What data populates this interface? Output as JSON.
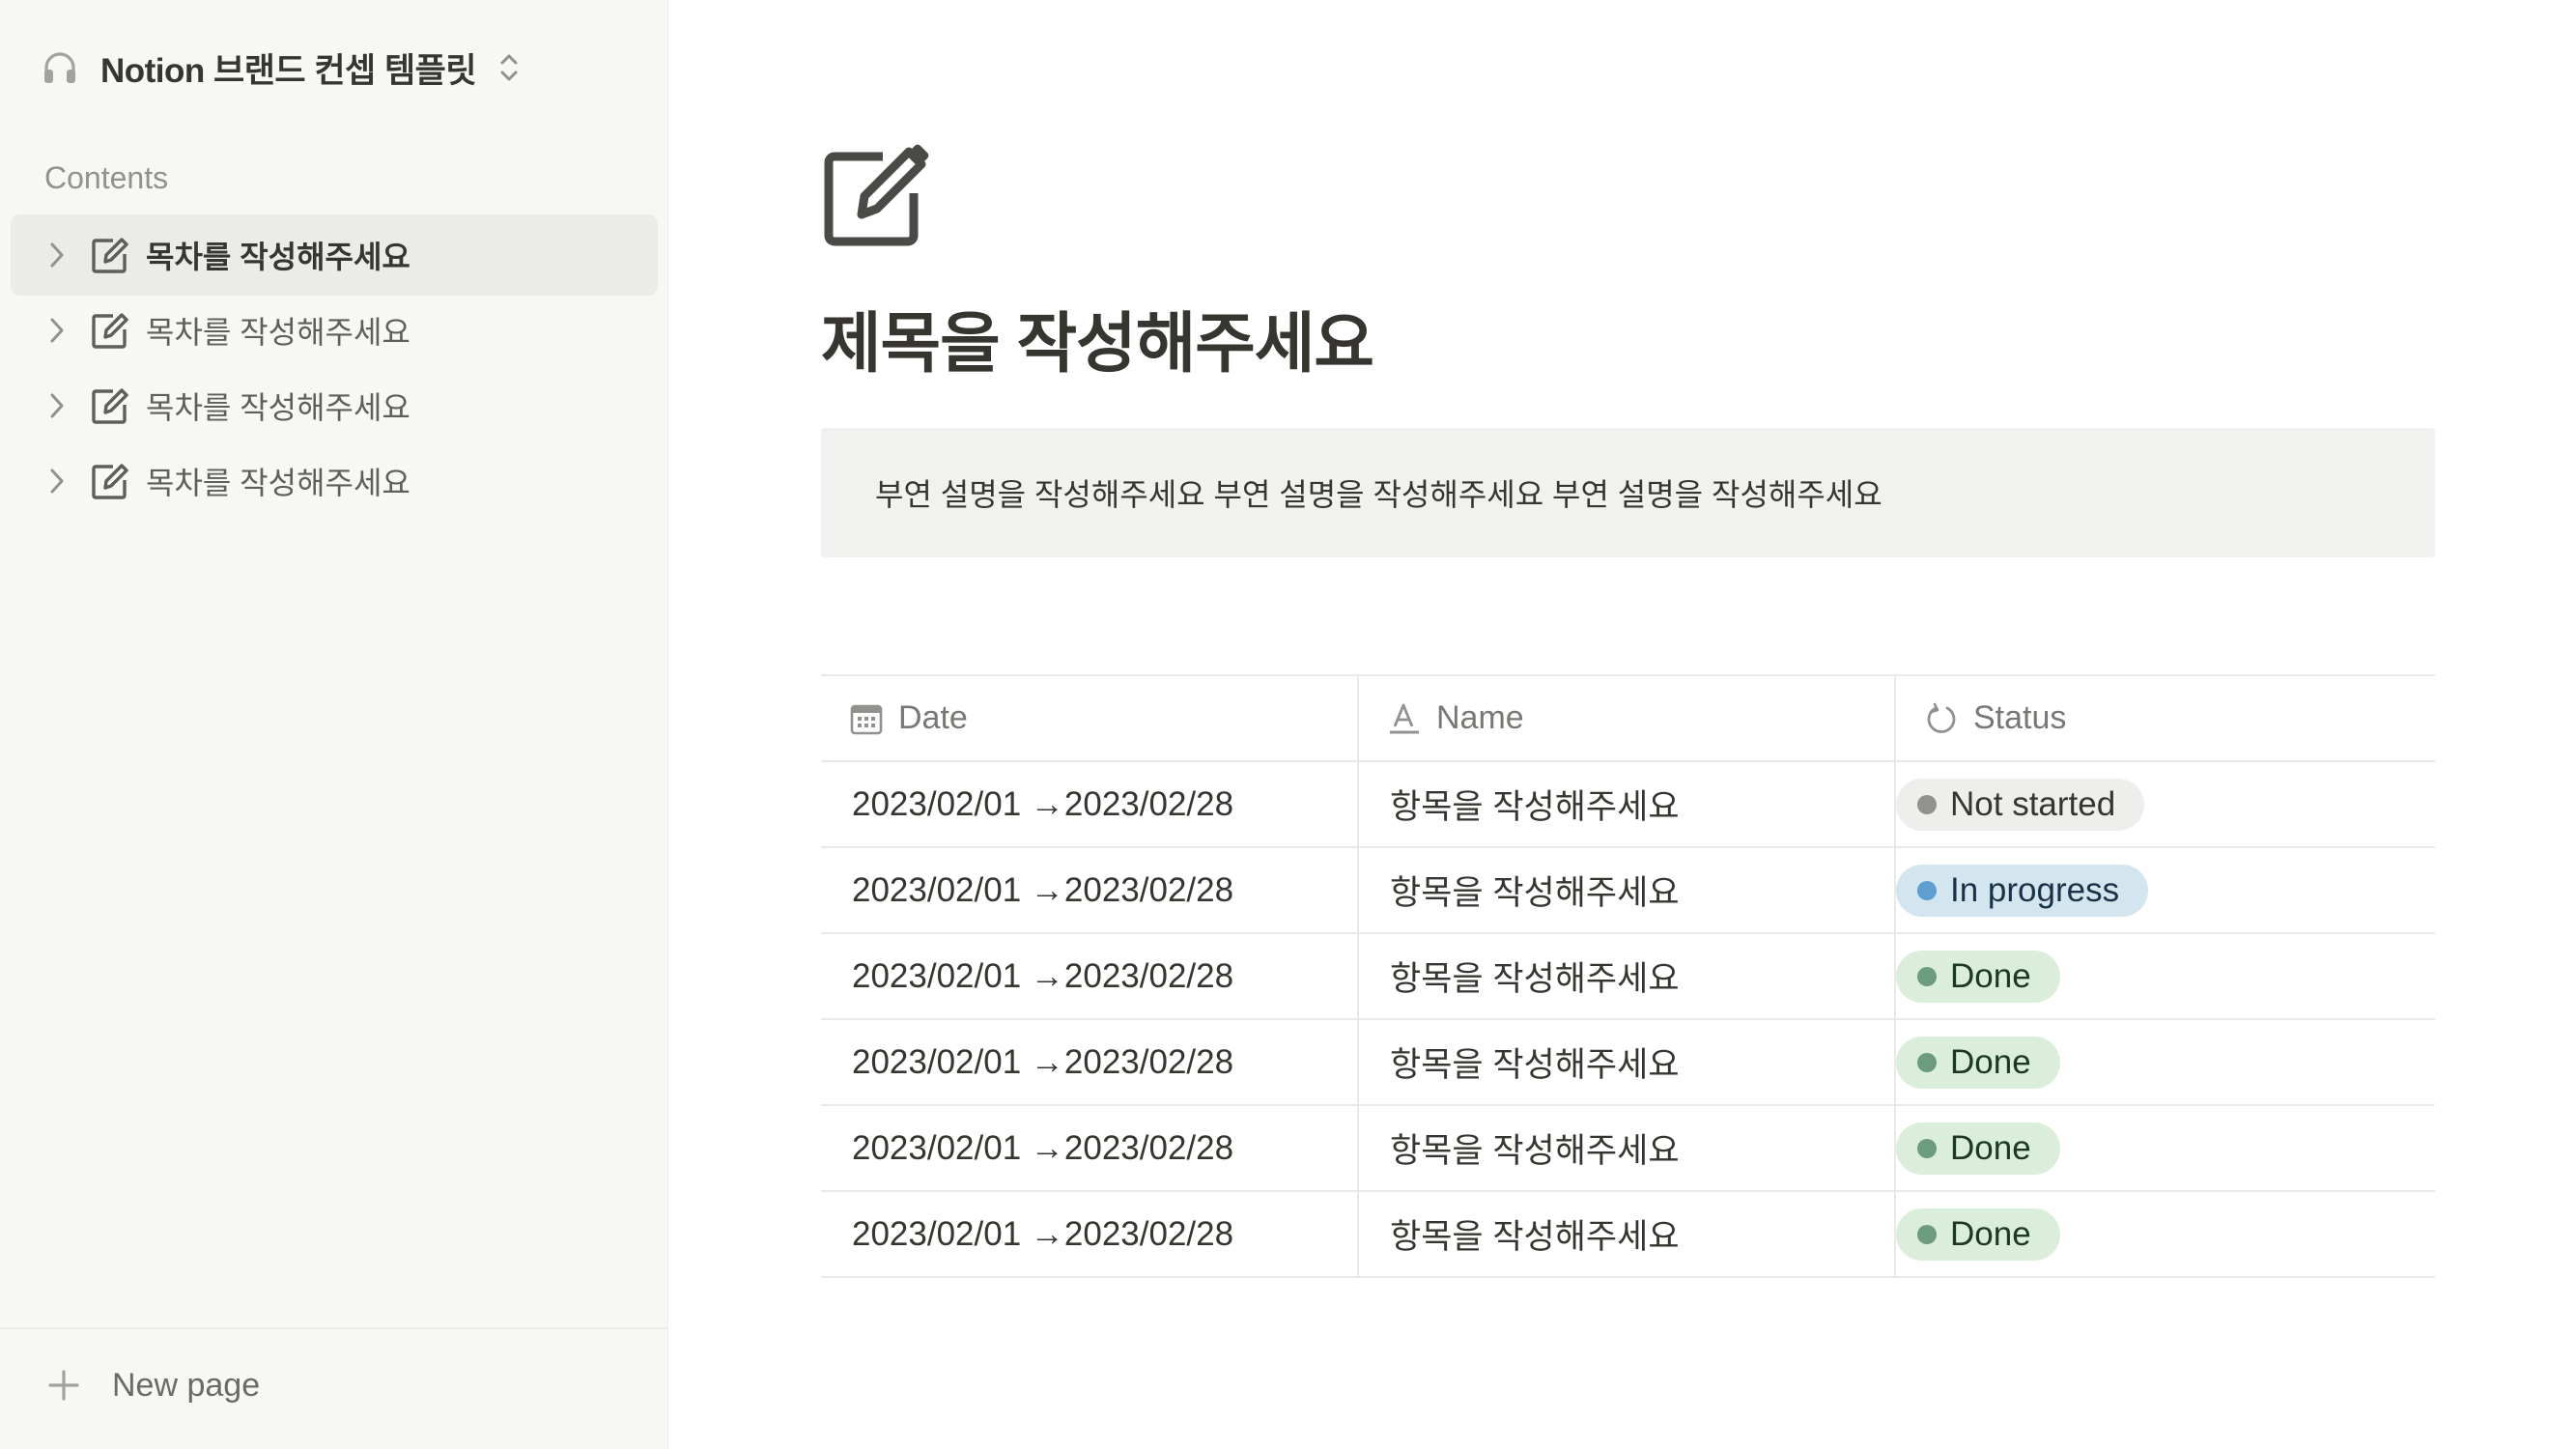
{
  "sidebar": {
    "workspace_name": "Notion 브랜드 컨셉 템플릿",
    "workspace_icon": "headphones-icon",
    "section_label": "Contents",
    "items": [
      {
        "label": "목차를 작성해주세요",
        "active": true
      },
      {
        "label": "목차를 작성해주세요",
        "active": false
      },
      {
        "label": "목차를 작성해주세요",
        "active": false
      },
      {
        "label": "목차를 작성해주세요",
        "active": false
      }
    ],
    "new_page_label": "New page"
  },
  "page": {
    "icon": "edit-icon",
    "title": "제목을 작성해주세요",
    "callout": "부연 설명을 작성해주세요 부연 설명을 작성해주세요 부연 설명을 작성해주세요"
  },
  "table": {
    "columns": [
      {
        "label": "Date",
        "icon": "calendar-icon"
      },
      {
        "label": "Name",
        "icon": "text-property-icon"
      },
      {
        "label": "Status",
        "icon": "status-icon"
      }
    ],
    "rows": [
      {
        "date": "2023/02/01 →2023/02/28",
        "name": "항목을 작성해주세요",
        "status": "Not started"
      },
      {
        "date": "2023/02/01 →2023/02/28",
        "name": "항목을 작성해주세요",
        "status": "In progress"
      },
      {
        "date": "2023/02/01 →2023/02/28",
        "name": "항목을 작성해주세요",
        "status": "Done"
      },
      {
        "date": "2023/02/01 →2023/02/28",
        "name": "항목을 작성해주세요",
        "status": "Done"
      },
      {
        "date": "2023/02/01 →2023/02/28",
        "name": "항목을 작성해주세요",
        "status": "Done"
      },
      {
        "date": "2023/02/01 →2023/02/28",
        "name": "항목을 작성해주세요",
        "status": "Done"
      }
    ]
  },
  "status_colors": {
    "Not started": {
      "bg": "#eeeeed",
      "dot": "#91918e",
      "text": "#37352f"
    },
    "In progress": {
      "bg": "#d3e5ef",
      "dot": "#5e9fd1",
      "text": "#183347"
    },
    "Done": {
      "bg": "#dbeddb",
      "dot": "#6c9b7d",
      "text": "#1c3829"
    }
  }
}
